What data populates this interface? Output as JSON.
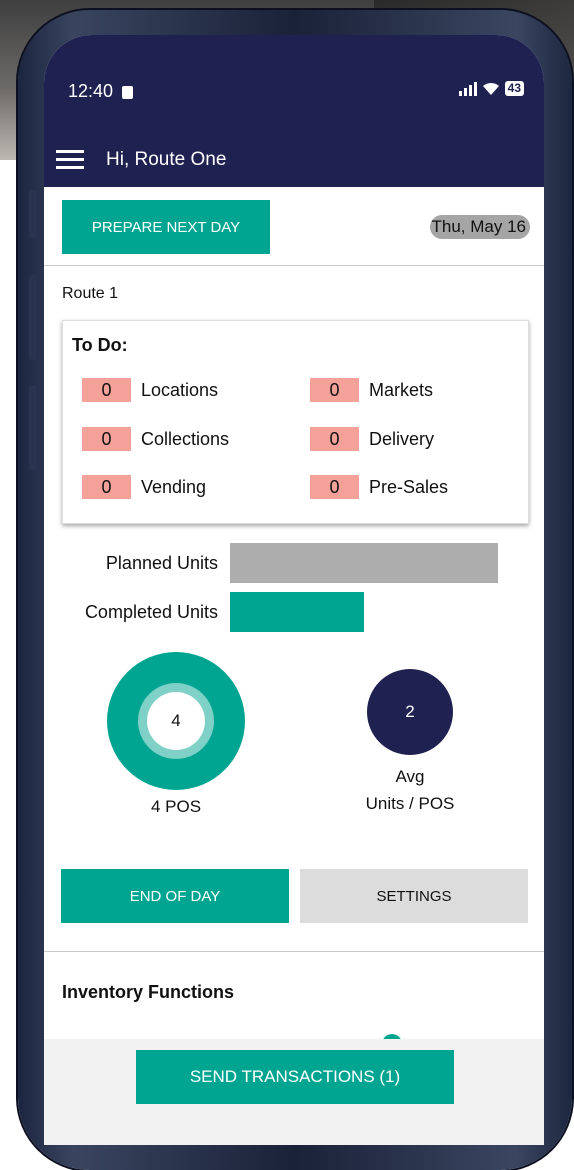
{
  "status_bar": {
    "time": "12:40",
    "battery": "43"
  },
  "app_bar": {
    "title": "Hi, Route One",
    "menu_icon": "hamburger-menu-icon"
  },
  "header": {
    "prepare_button": "PREPARE NEXT DAY",
    "date": "Thu, May 16"
  },
  "route": {
    "name": "Route 1"
  },
  "todo": {
    "title": "To Do:",
    "items": [
      {
        "count": "0",
        "label": "Locations"
      },
      {
        "count": "0",
        "label": "Markets"
      },
      {
        "count": "0",
        "label": "Collections"
      },
      {
        "count": "0",
        "label": "Delivery"
      },
      {
        "count": "0",
        "label": "Vending"
      },
      {
        "count": "0",
        "label": "Pre-Sales"
      }
    ]
  },
  "units": {
    "planned_label": "Planned Units",
    "completed_label": "Completed Units",
    "completed_fraction_of_planned": 0.5
  },
  "stats": {
    "pos_count": "4",
    "pos_label": "4 POS",
    "avg_value": "2",
    "avg_label_line1": "Avg",
    "avg_label_line2": "Units / POS"
  },
  "actions": {
    "end_of_day": "END OF DAY",
    "settings": "SETTINGS"
  },
  "inventory": {
    "title": "Inventory Functions",
    "icons": [
      "inventory-rack-icon",
      "person-icon"
    ]
  },
  "footer": {
    "send_button": "SEND TRANSACTIONS (1)"
  },
  "colors": {
    "navy": "#1f2251",
    "teal": "#00a592",
    "todo_badge": "#f4a199",
    "gray_bar": "#adadad"
  }
}
